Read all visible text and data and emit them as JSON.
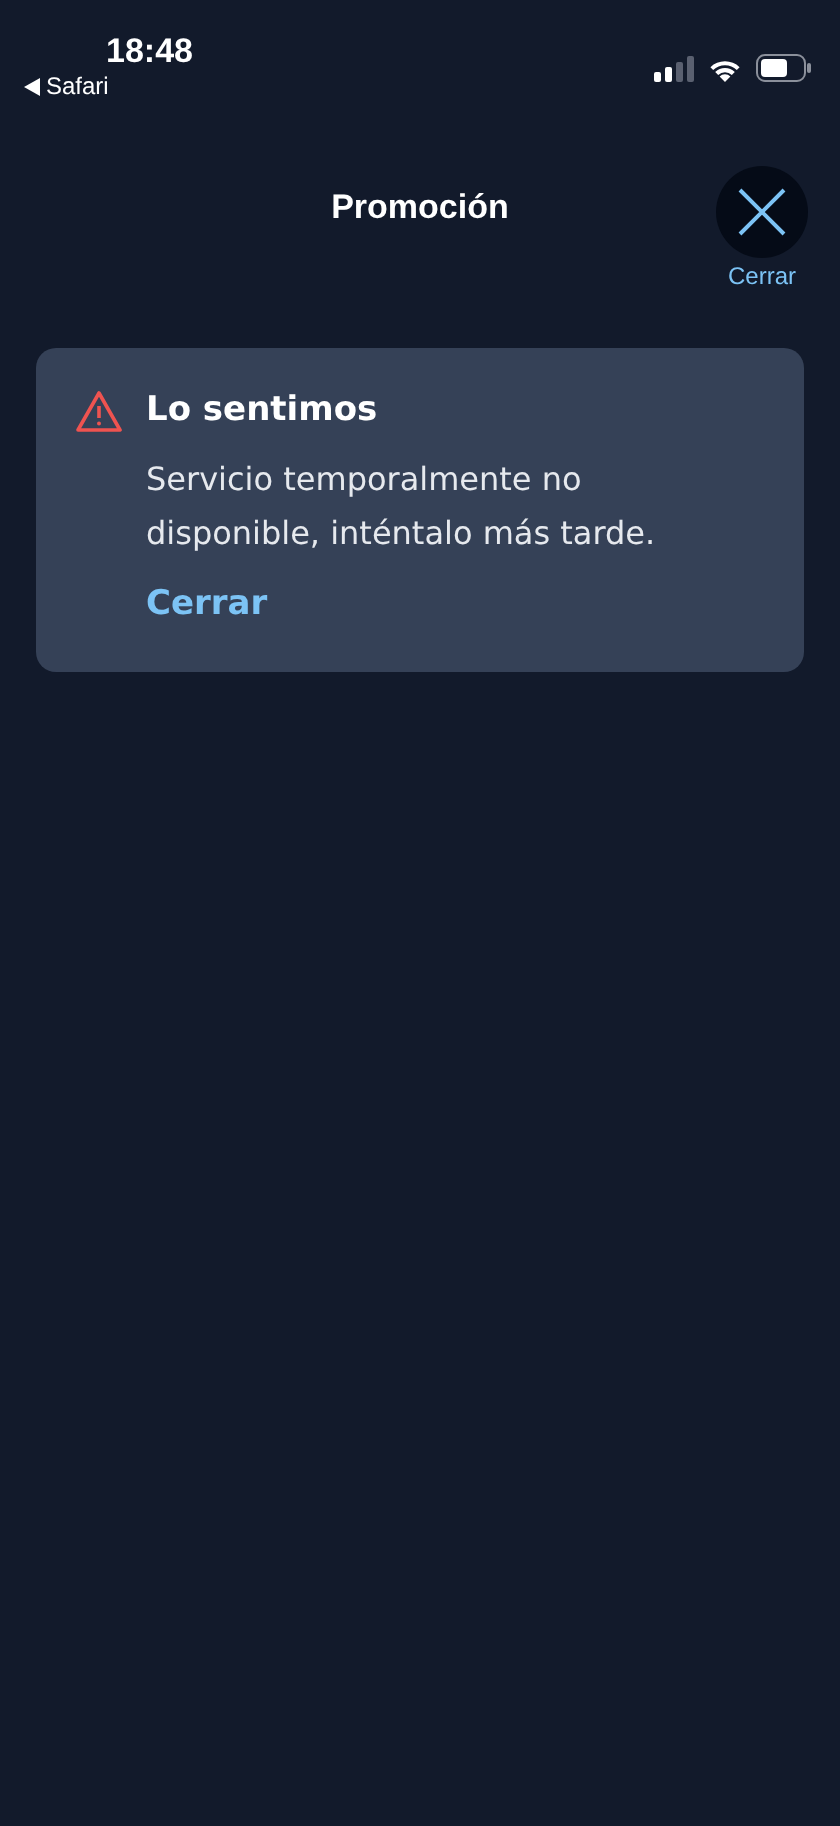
{
  "status_bar": {
    "time": "18:48",
    "back_label": "Safari"
  },
  "header": {
    "title": "Promoción",
    "close_label": "Cerrar"
  },
  "alert": {
    "title": "Lo sentimos",
    "message": "Servicio temporalmente no disponible, inténtalo más tarde.",
    "action": "Cerrar"
  }
}
